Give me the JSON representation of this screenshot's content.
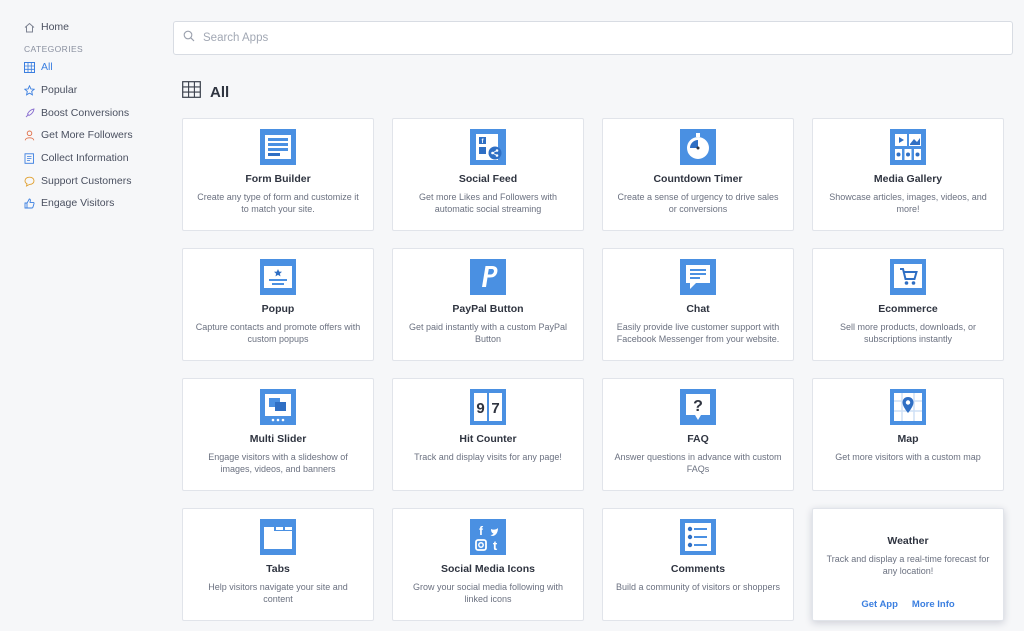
{
  "sidebar": {
    "home": "Home",
    "categories_heading": "CATEGORIES",
    "items": [
      {
        "label": "All",
        "icon": "grid-icon",
        "active": true
      },
      {
        "label": "Popular",
        "icon": "star-icon"
      },
      {
        "label": "Boost Conversions",
        "icon": "rocket-icon"
      },
      {
        "label": "Get More Followers",
        "icon": "user-icon"
      },
      {
        "label": "Collect Information",
        "icon": "form-icon"
      },
      {
        "label": "Support Customers",
        "icon": "chat-bubble-icon"
      },
      {
        "label": "Engage Visitors",
        "icon": "thumbs-up-icon"
      }
    ]
  },
  "search": {
    "placeholder": "Search Apps",
    "value": ""
  },
  "section": {
    "title": "All"
  },
  "apps": [
    {
      "title": "Form Builder",
      "desc": "Create any type of form and customize it to match your site.",
      "icon": "form-builder-icon"
    },
    {
      "title": "Social Feed",
      "desc": "Get more Likes and Followers with automatic social streaming",
      "icon": "social-feed-icon"
    },
    {
      "title": "Countdown Timer",
      "desc": "Create a sense of urgency to drive sales or conversions",
      "icon": "countdown-timer-icon"
    },
    {
      "title": "Media Gallery",
      "desc": "Showcase articles, images, videos, and more!",
      "icon": "media-gallery-icon"
    },
    {
      "title": "Popup",
      "desc": "Capture contacts and promote offers with custom popups",
      "icon": "popup-icon"
    },
    {
      "title": "PayPal Button",
      "desc": "Get paid instantly with a custom PayPal Button",
      "icon": "paypal-icon"
    },
    {
      "title": "Chat",
      "desc": "Easily provide live customer support with Facebook Messenger from your website.",
      "icon": "chat-icon"
    },
    {
      "title": "Ecommerce",
      "desc": "Sell more products, downloads, or subscriptions instantly",
      "icon": "ecommerce-icon"
    },
    {
      "title": "Multi Slider",
      "desc": "Engage visitors with a slideshow of images, videos, and banners",
      "icon": "multi-slider-icon"
    },
    {
      "title": "Hit Counter",
      "desc": "Track and display visits for any page!",
      "icon": "hit-counter-icon"
    },
    {
      "title": "FAQ",
      "desc": "Answer questions in advance with custom FAQs",
      "icon": "faq-icon"
    },
    {
      "title": "Map",
      "desc": "Get more visitors with a custom map",
      "icon": "map-icon"
    },
    {
      "title": "Tabs",
      "desc": "Help visitors navigate your site and content",
      "icon": "tabs-icon"
    },
    {
      "title": "Social Media Icons",
      "desc": "Grow your social media following with linked icons",
      "icon": "social-media-icons-icon"
    },
    {
      "title": "Comments",
      "desc": "Build a community of visitors or shoppers",
      "icon": "comments-icon"
    },
    {
      "title": "Weather",
      "desc": "Track and display a real-time forecast for any location!",
      "icon": "weather-icon",
      "hover": true,
      "actions": [
        "Get App",
        "More Info"
      ]
    }
  ],
  "colors": {
    "accent": "#3b7fe0",
    "icon_blue": "#4a90e2",
    "icon_dark": "#2f6fc4"
  }
}
